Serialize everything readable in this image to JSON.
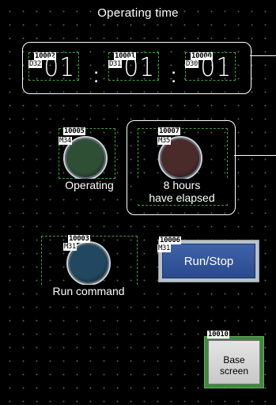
{
  "title": "Operating time",
  "counters": [
    {
      "id": "10002",
      "device": "D32",
      "value": "01"
    },
    {
      "id": "10001",
      "device": "D31",
      "value": "01"
    },
    {
      "id": "10000",
      "device": "D30",
      "value": "01"
    }
  ],
  "separator": ":",
  "lamps": {
    "operating": {
      "id": "10005",
      "device": "M34",
      "label": "Operating",
      "color": "#2f4f35"
    },
    "elapsed": {
      "id": "10007",
      "device": "M35",
      "label_line1": "8 hours",
      "label_line2": "have elapsed",
      "color": "#4b2a2a"
    },
    "run_command": {
      "id": "10003",
      "device": "M31",
      "label": "Run command",
      "color": "#224861"
    }
  },
  "run_stop_button": {
    "id": "10006",
    "device": "M31",
    "label": "Run/Stop"
  },
  "base_button": {
    "id": "10010",
    "label_line1": "Base",
    "label_line2": "screen"
  }
}
